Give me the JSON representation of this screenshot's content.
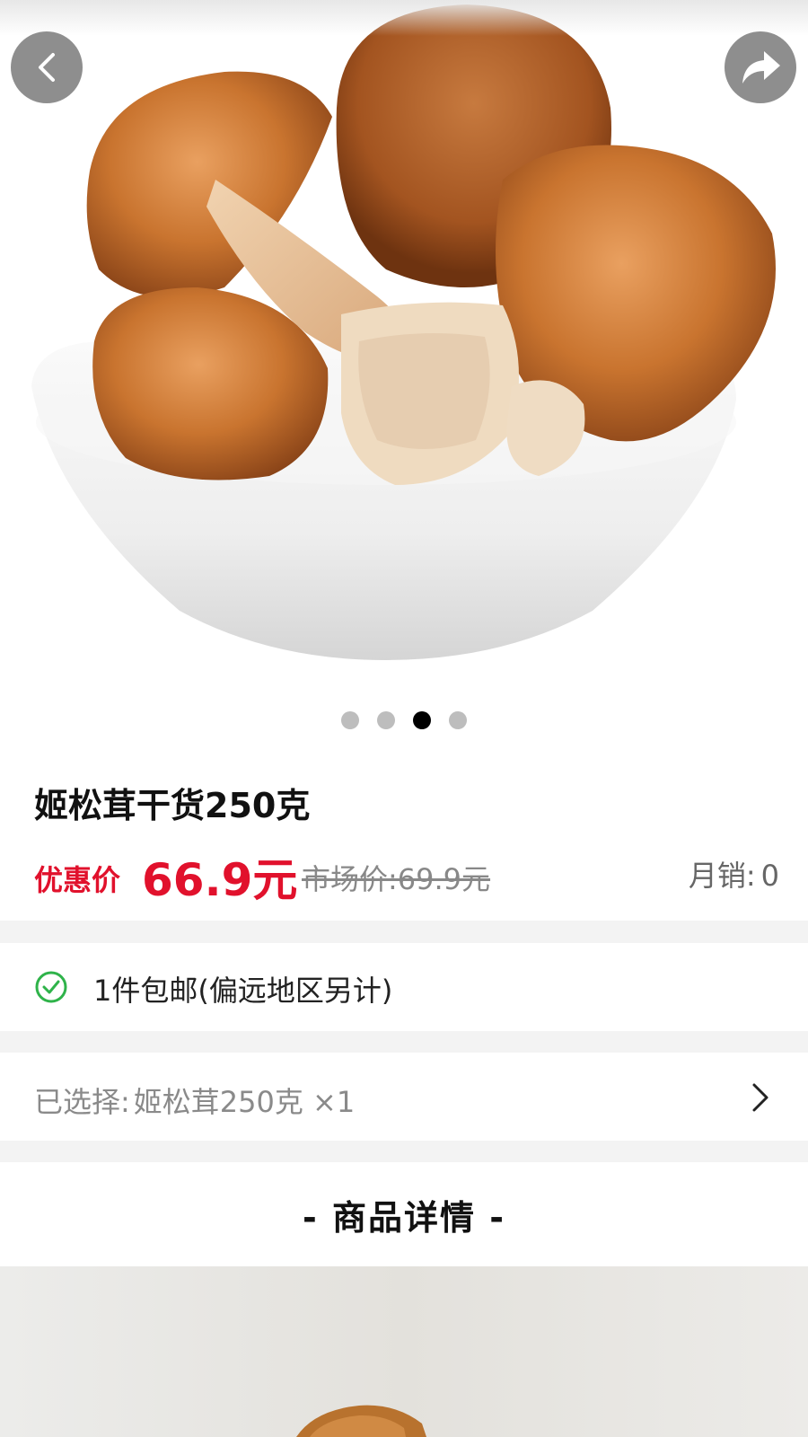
{
  "product": {
    "title": "姬松茸干货250克",
    "price_label": "优惠价",
    "price_value": "66.9元",
    "market_price": "市场价:69.9元",
    "monthly_sales_label": "月销:",
    "monthly_sales_value": "0"
  },
  "gallery": {
    "image_count": 4,
    "active_index": 2
  },
  "shipping": {
    "text": "1件包邮(偏远地区另计)",
    "icon": "check-circle-icon"
  },
  "selection": {
    "label": "已选择:",
    "value": "姬松茸250克 ×1"
  },
  "details": {
    "header": "- 商品详情 -"
  },
  "colors": {
    "accent_red": "#e1112c",
    "check_green": "#2fb34a"
  }
}
